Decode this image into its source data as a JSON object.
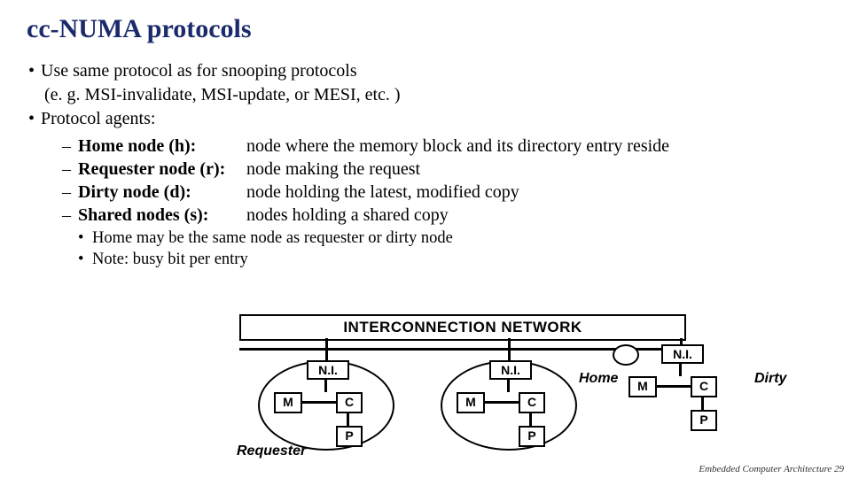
{
  "title": "cc-NUMA protocols",
  "bullets": {
    "b1": "Use same protocol as for snooping protocols",
    "b1_sub": "(e. g. MSI-invalidate, MSI-update, or MESI, etc. )",
    "b2": "Protocol agents:"
  },
  "agents": [
    {
      "term": "Home node (h):",
      "desc": "node where the memory block and its directory entry reside"
    },
    {
      "term": "Requester node (r):",
      "desc": "node making the request"
    },
    {
      "term": "Dirty node (d):",
      "desc": "node holding the latest, modified copy"
    },
    {
      "term": "Shared nodes (s):",
      "desc": "nodes holding a shared copy"
    }
  ],
  "notes": {
    "n1": "Home may be the same node as requester or dirty node",
    "n2": "Note: busy bit per entry"
  },
  "diagram": {
    "network": "INTERCONNECTION NETWORK",
    "ni": "N.I.",
    "m": "M",
    "c": "C",
    "p": "P",
    "labels": {
      "requester": "Requester",
      "home": "Home",
      "dirty": "Dirty"
    }
  },
  "footer": {
    "text": "Embedded Computer Architecture",
    "page": "29"
  }
}
